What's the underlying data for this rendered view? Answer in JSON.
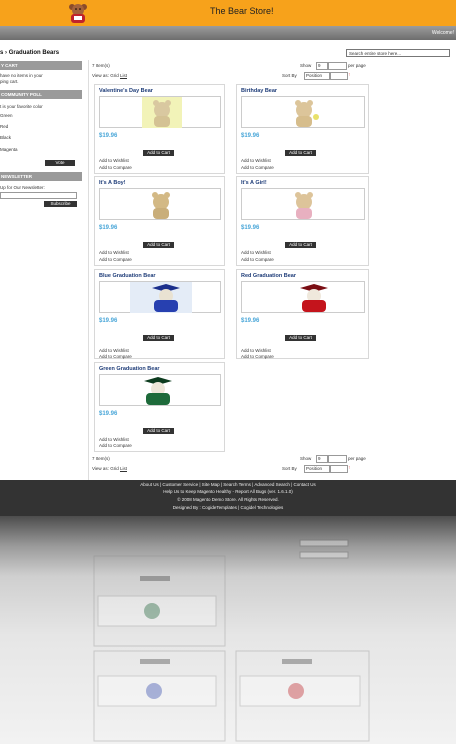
{
  "header": {
    "store_title": "The Bear Store!",
    "welcome": "Welcome!"
  },
  "breadcrumb": {
    "home": "s",
    "separator": "›",
    "current": "Graduation Bears"
  },
  "search": {
    "placeholder": "Search entire store here..."
  },
  "sidebar": {
    "cart_title": "Y CART",
    "cart_text_1": "have no items in your",
    "cart_text_2": "ping cart.",
    "poll_title": "COMMUNITY POLL",
    "poll_question": "t is your favorite color",
    "poll_options": [
      "Green",
      "Red",
      "Black",
      "Magenta"
    ],
    "vote_label": "Vote",
    "newsletter_title": "NEWSLETTER",
    "newsletter_text": "Up for Our Newsletter:",
    "subscribe_label": "Subscribe"
  },
  "toolbar": {
    "items_count": "7 Item(s)",
    "show_label": "Show",
    "show_value": "9",
    "per_page_label": "per page",
    "view_as_label": "View as:",
    "view_grid": "Grid",
    "view_list": "List",
    "sort_label": "Sort By",
    "sort_value": "Position"
  },
  "products": [
    {
      "name": "Valentine's Day Bear",
      "price": "$19.96",
      "cart": "Add to Cart",
      "wishlist": "Add to Wishlist",
      "compare": "Add to Compare"
    },
    {
      "name": "Birthday Bear",
      "price": "$19.96",
      "cart": "Add to Cart",
      "wishlist": "Add to Wishlist",
      "compare": "Add to Compare"
    },
    {
      "name": "It's A Boy!",
      "price": "$19.96",
      "cart": "Add to Cart",
      "wishlist": "Add to Wishlist",
      "compare": "Add to Compare"
    },
    {
      "name": "It's A Girl!",
      "price": "$19.96",
      "cart": "Add to Cart",
      "wishlist": "Add to Wishlist",
      "compare": "Add to Compare"
    },
    {
      "name": "Blue Graduation Bear",
      "price": "$19.96",
      "cart": "Add to Cart",
      "wishlist": "Add to Wishlist",
      "compare": "Add to Compare"
    },
    {
      "name": "Red Graduation Bear",
      "price": "$19.96",
      "cart": "Add to Cart",
      "wishlist": "Add to Wishlist",
      "compare": "Add to Compare"
    },
    {
      "name": "Green Graduation Bear",
      "price": "$19.96",
      "cart": "Add to Cart",
      "wishlist": "Add to Wishlist",
      "compare": "Add to Compare"
    }
  ],
  "footer": {
    "links": "About Us | Customer Service | Site Map | Search Terms | Advanced Search | Contact Us",
    "help_line": "Help Us to Keep Magento Healthy - Report All Bugs (ver. 1.6.1.0)",
    "copyright": "© 2008 Magento Demo Store. All Rights Reserved.",
    "designed_by": "Designed By : CogideTemplates | Cogidel Technologies"
  },
  "colors": {
    "header": "#f7a21b",
    "price": "#49a6d8",
    "product_name": "#1e3c78",
    "footer": "#333333"
  }
}
